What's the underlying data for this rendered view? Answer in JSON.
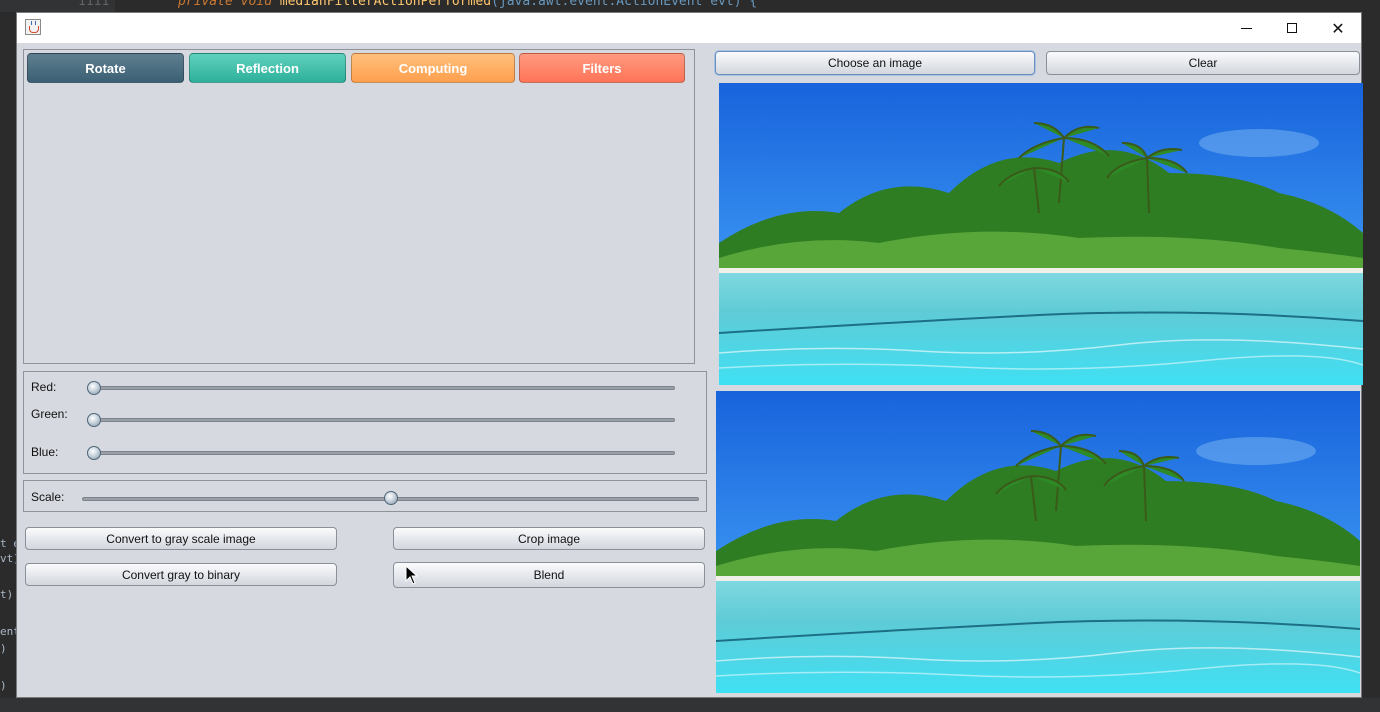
{
  "background_ide": {
    "line_number": "1111",
    "code_prefix": "private void ",
    "code_method": "medianFilterActionPerformed",
    "code_rest": "(java.awt.event.ActionEvent evt) {",
    "left_fragments": [
      "t e",
      "vt)",
      "t)",
      "ent",
      ")",
      ")",
      ")"
    ]
  },
  "window": {
    "title": "",
    "controls": {
      "minimize": "minimize",
      "maximize": "maximize",
      "close": "✕"
    }
  },
  "tabs": [
    {
      "label": "Rotate",
      "color": "#4a6b7c"
    },
    {
      "label": "Reflection",
      "color": "#3cc1ab"
    },
    {
      "label": "Computing",
      "color": "#ffb066"
    },
    {
      "label": "Filters",
      "color": "#ff8366"
    }
  ],
  "sliders": {
    "red": {
      "label": "Red:",
      "value": 0
    },
    "green": {
      "label": "Green:",
      "value": 0
    },
    "blue": {
      "label": "Blue:",
      "value": 0
    },
    "scale": {
      "label": "Scale:",
      "value": 50
    }
  },
  "buttons": {
    "gray": "Convert to gray scale image",
    "crop": "Crop image",
    "binary": "Convert gray to binary",
    "blend": "Blend",
    "choose": "Choose an image",
    "clear": "Clear"
  },
  "images": {
    "top": {
      "description_icon": "image-icon"
    },
    "bottom": {
      "description_icon": "image-icon"
    }
  },
  "colors": {
    "window_bg": "#d6d9df",
    "sky": "#1b6fe0",
    "water": "#38d6ef"
  }
}
